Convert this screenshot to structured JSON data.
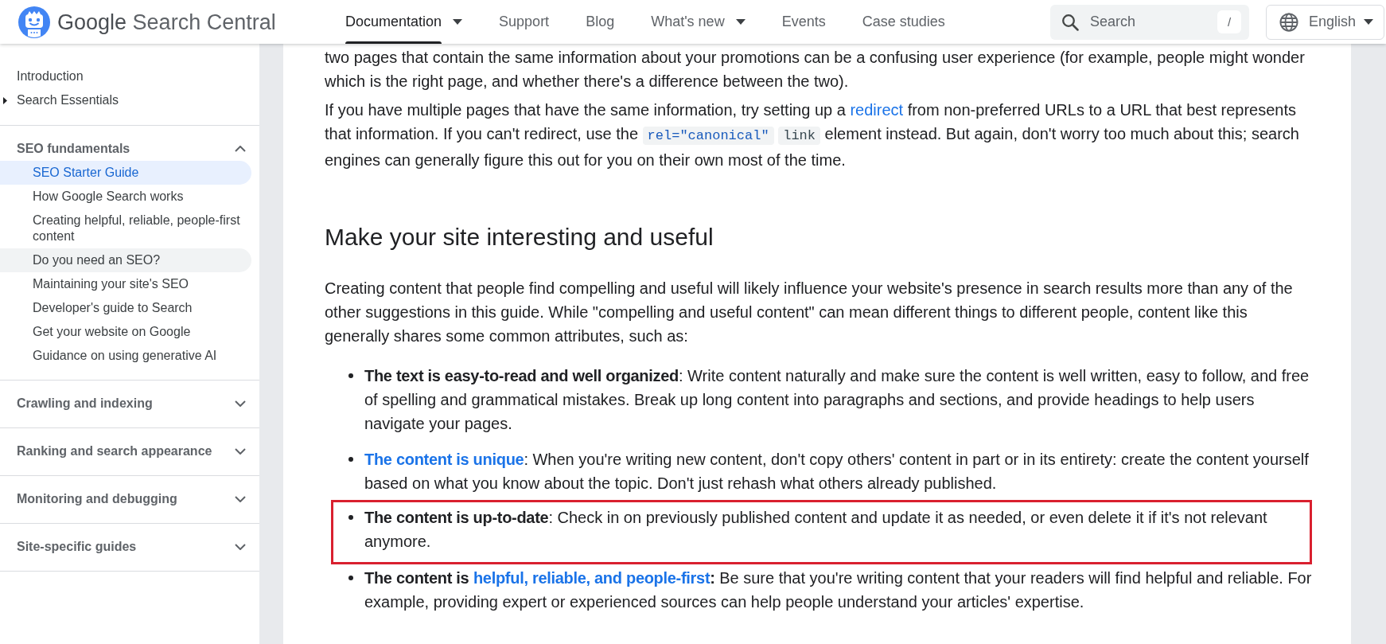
{
  "header": {
    "logo": {
      "brand": "Google",
      "product": "Search Central"
    },
    "nav": [
      {
        "label": "Documentation",
        "selected": true,
        "dropdown": true
      },
      {
        "label": "Support",
        "selected": false,
        "dropdown": false
      },
      {
        "label": "Blog",
        "selected": false,
        "dropdown": false
      },
      {
        "label": "What's new",
        "selected": false,
        "dropdown": true
      },
      {
        "label": "Events",
        "selected": false,
        "dropdown": false
      },
      {
        "label": "Case studies",
        "selected": false,
        "dropdown": false
      }
    ],
    "search": {
      "placeholder": "Search",
      "shortcut": "/"
    },
    "language": {
      "label": "English"
    }
  },
  "sidebar": {
    "sections": [
      {
        "kind": "links",
        "items": [
          {
            "kind": "link",
            "label": "Introduction",
            "selected": false
          },
          {
            "kind": "toggle",
            "label": "Search Essentials",
            "expanded": false
          }
        ]
      },
      {
        "kind": "group",
        "label": "SEO fundamentals",
        "expanded": true,
        "children": [
          {
            "label": "SEO Starter Guide",
            "selected": true,
            "hovered": false
          },
          {
            "label": "How Google Search works",
            "selected": false,
            "hovered": false
          },
          {
            "label": "Creating helpful, reliable, people-first content",
            "selected": false,
            "hovered": false
          },
          {
            "label": "Do you need an SEO?",
            "selected": false,
            "hovered": true
          },
          {
            "label": "Maintaining your site's SEO",
            "selected": false,
            "hovered": false
          },
          {
            "label": "Developer's guide to Search",
            "selected": false,
            "hovered": false
          },
          {
            "label": "Get your website on Google",
            "selected": false,
            "hovered": false
          },
          {
            "label": "Guidance on using generative AI",
            "selected": false,
            "hovered": false
          }
        ]
      },
      {
        "kind": "group",
        "label": "Crawling and indexing",
        "expanded": false
      },
      {
        "kind": "group",
        "label": "Ranking and search appearance",
        "expanded": false
      },
      {
        "kind": "group",
        "label": "Monitoring and debugging",
        "expanded": false
      },
      {
        "kind": "group",
        "label": "Site-specific guides",
        "expanded": false
      }
    ]
  },
  "content": {
    "blocks": [
      {
        "kind": "paragraph",
        "parts": [
          {
            "kind": "text",
            "text": "two pages that contain the same information about your promotions can be a confusing user experience (for example, people might wonder which is the right page, and whether there's a difference between the two)."
          }
        ]
      },
      {
        "kind": "paragraph",
        "parts": [
          {
            "kind": "text",
            "text": "If you have multiple pages that have the same information, try setting up a "
          },
          {
            "kind": "link",
            "text": "redirect"
          },
          {
            "kind": "text",
            "text": " from non-preferred URLs to a URL that best represents that information. If you can't redirect, use the "
          },
          {
            "kind": "code_link",
            "text": "rel=\"canonical\""
          },
          {
            "kind": "code",
            "text": "link"
          },
          {
            "kind": "text",
            "text": " element instead. But again, don't worry too much about this; search engines can generally figure this out for you on their own most of the time."
          }
        ]
      },
      {
        "kind": "heading",
        "text": "Make your site interesting and useful"
      },
      {
        "kind": "paragraph",
        "parts": [
          {
            "kind": "text",
            "text": "Creating content that people find compelling and useful will likely influence your website's presence in search results more than any of the other suggestions in this guide. While \"compelling and useful content\" can mean different things to different people, content like this generally shares some common attributes, such as:"
          }
        ]
      },
      {
        "kind": "list",
        "items": [
          {
            "highlighted": false,
            "parts": [
              {
                "kind": "text",
                "text": "**The text is easy-to-read and well organized**: Write content naturally and make sure the content is well written, easy to follow, and free of spelling and grammatical mistakes. Break up long content into paragraphs and sections, and provide headings to help users navigate your pages."
              }
            ]
          },
          {
            "highlighted": false,
            "parts": [
              {
                "kind": "strong_link",
                "text": "The content is unique"
              },
              {
                "kind": "text",
                "text": ": When you're writing new content, don't copy others' content in part or in its entirety: create the content yourself based on what you know about the topic. Don't just rehash what others already published."
              }
            ]
          },
          {
            "highlighted": true,
            "parts": [
              {
                "kind": "text",
                "text": "**The content is up-to-date**: Check in on previously published content and update it as needed, or even delete it if it's not relevant anymore."
              }
            ]
          },
          {
            "highlighted": false,
            "parts": [
              {
                "kind": "text",
                "text": "**The content is** "
              },
              {
                "kind": "strong_link",
                "text": "helpful, reliable, and people-first"
              },
              {
                "kind": "text",
                "text": "**:** Be sure that you're writing content that your readers will find helpful and reliable. For example, providing expert or experienced sources can help people understand your articles' expertise."
              }
            ]
          }
        ]
      }
    ]
  }
}
